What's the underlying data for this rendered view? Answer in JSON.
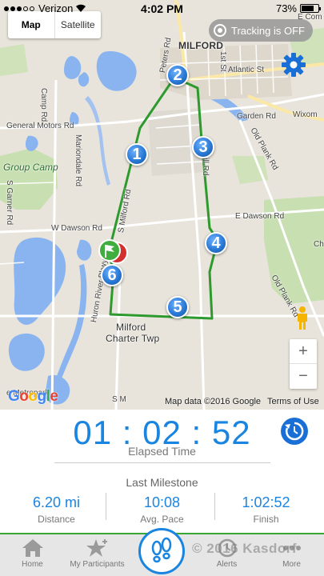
{
  "status_bar": {
    "carrier": "Verizon",
    "time": "4:02 PM",
    "battery": "73%",
    "battery_level": 0.73
  },
  "map": {
    "type_toggle": {
      "map": "Map",
      "satellite": "Satellite",
      "selected": "Map"
    },
    "tracking": "Tracking is OFF",
    "labels": {
      "milford": "MILFORD",
      "atlantic": "Atlantic St",
      "gm_rd": "General Motors Rd",
      "garden": "Garden Rd",
      "wixom": "Wixom",
      "group_camp": "Group Camp",
      "camp_rd": "Camp Rd",
      "mariondale": "Mariondale Rd",
      "s_garner": "S Garner Rd",
      "w_dawson": "W Dawson Rd",
      "e_dawson": "E Dawson Rd",
      "old_plank_1": "Old Plank Rd",
      "old_plank_2": "Old Plank Rd",
      "milford_rd": "S Milford Rd",
      "hill_rd": "Hill Rd",
      "huron_river": "Huron River Pkwy",
      "peters": "Peters Rd",
      "first_st": "1st St",
      "milford_twp_1": "Milford",
      "milford_twp_2": "Charter Twp",
      "e_frag": "E Com",
      "chic_frag": "Chic",
      "s_m_frag": "S M",
      "metropark": "e Metropark"
    },
    "milestones": [
      "1",
      "2",
      "3",
      "4",
      "5",
      "6"
    ],
    "google_logo": "Google",
    "attribution": "Map data ©2016 Google",
    "terms": "Terms of Use",
    "zoom_in": "+",
    "zoom_out": "−",
    "route_color": "#2e9a2e"
  },
  "timer": {
    "elapsed": "01 : 02 : 52",
    "label": "Elapsed Time"
  },
  "milestone": {
    "title": "Last Milestone",
    "stats": [
      {
        "value": "6.20 mi",
        "label": "Distance"
      },
      {
        "value": "10:08",
        "label": "Avg. Pace"
      },
      {
        "value": "1:02:52",
        "label": "Finish"
      }
    ]
  },
  "tabs": {
    "home": "Home",
    "participants": "My Participants",
    "alerts": "Alerts",
    "more": "More"
  },
  "watermark": "© 2016 Kasdorf",
  "colors": {
    "accent": "#1a85e0",
    "route": "#2e9a2e",
    "tab_border": "#3aa635"
  }
}
